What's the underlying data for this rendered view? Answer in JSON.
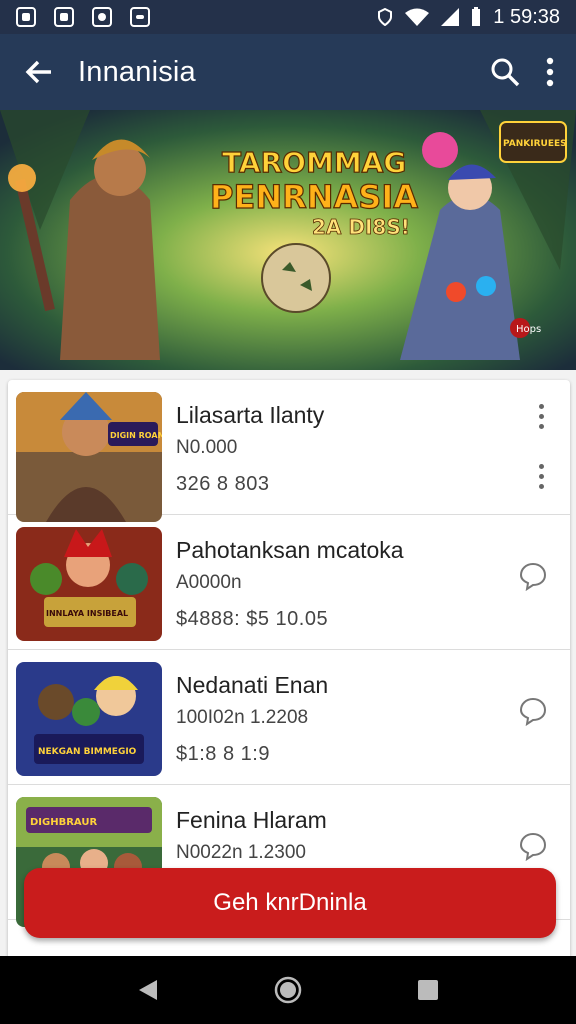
{
  "status": {
    "time": "1 59:38"
  },
  "appbar": {
    "title": "Innanisia"
  },
  "banner": {
    "title_line1": "TAROMMAG",
    "title_line2": "PENRNASIA",
    "tagline": "2A DI8S!",
    "badge": "PANKIRUEES",
    "corner": "Hops"
  },
  "items": [
    {
      "name": "Lilasarta Ilanty",
      "sub": "N0.000",
      "price": "326  8  803",
      "art": "DIGIN ROAM"
    },
    {
      "name": "Pahotanksan mcatoka",
      "sub": "A0000n",
      "price": "$4888:  $5 10.05",
      "art": "INNLAYA INSIBEAL"
    },
    {
      "name": "Nedanati Enan",
      "sub": "100I02n 1.2208",
      "price": "$1:8  8  1:9",
      "art": "NEKGAN BIMMEGIO"
    },
    {
      "name": "Fenina Hlaram",
      "sub": "N0022n 1.2300",
      "price": "",
      "art": "DIGHBRAUR"
    }
  ],
  "cta": {
    "label": "Geh knrDninla"
  },
  "colors": {
    "appbar": "#263a58",
    "statusbar": "#24314a",
    "cta": "#c91c1c"
  }
}
